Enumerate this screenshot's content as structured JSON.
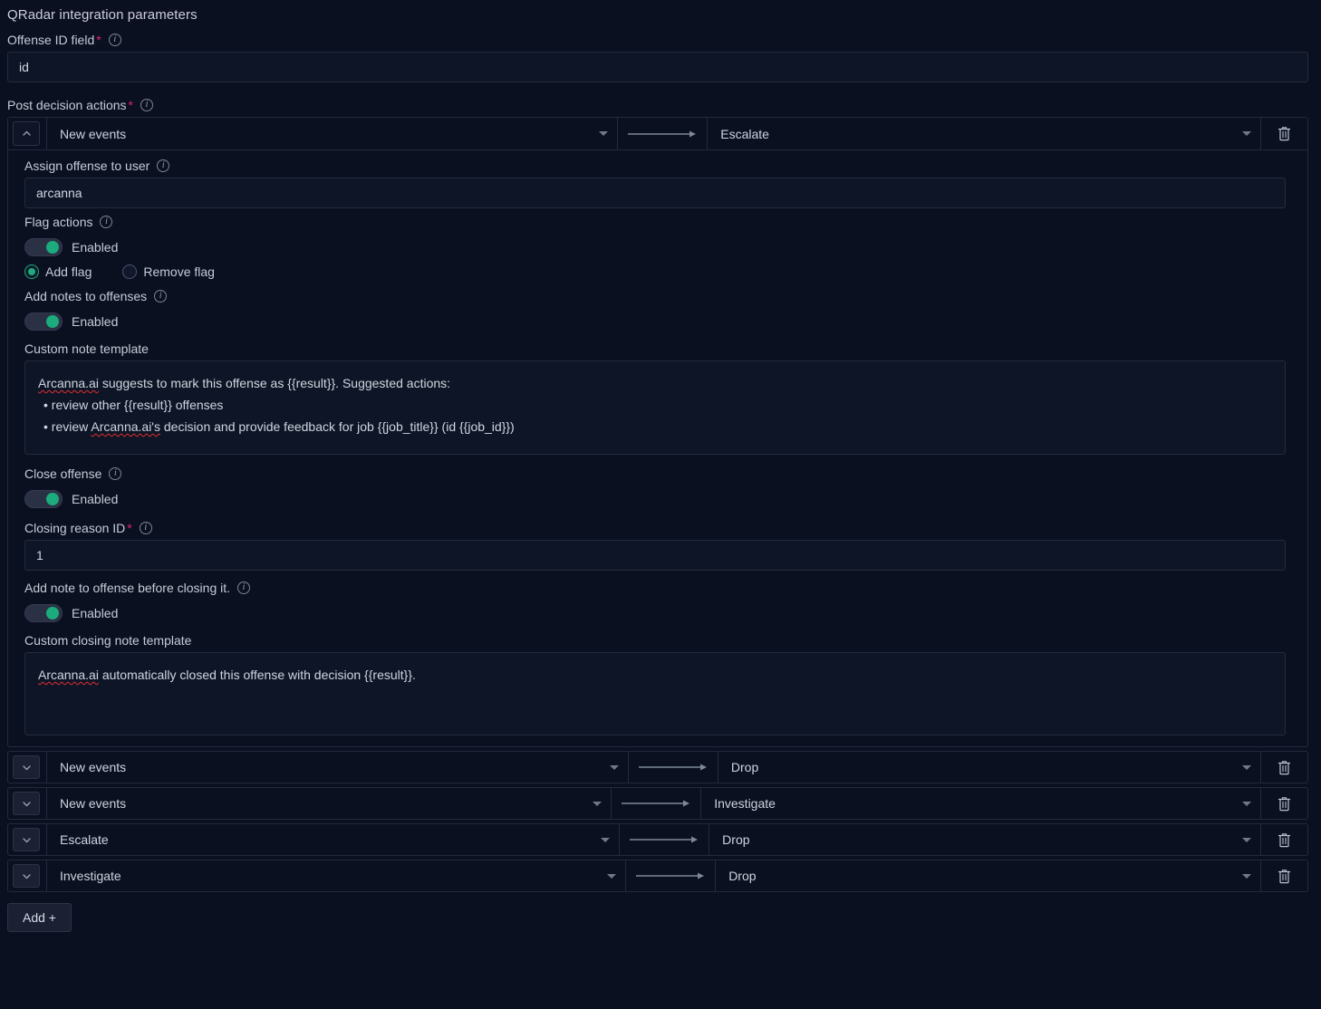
{
  "section": {
    "title": "QRadar integration parameters"
  },
  "offense_id": {
    "label": "Offense ID field",
    "required_marker": "*",
    "info_icon": "info-icon",
    "value": "id"
  },
  "post_decision": {
    "label": "Post decision actions",
    "required_marker": "*",
    "info_icon": "info-icon"
  },
  "expanded_row": {
    "collapse_icon": "chevron-up-icon",
    "trigger": "New events",
    "arrow_icon": "arrow-right-icon",
    "action": "Escalate",
    "delete_icon": "trash-icon",
    "caret_icon": "chevron-down-icon"
  },
  "assign_user": {
    "label": "Assign offense to user",
    "info_icon": "info-icon",
    "value": "arcanna"
  },
  "flag_actions": {
    "label": "Flag actions",
    "info_icon": "info-icon",
    "toggle_label": "Enabled",
    "toggle_on": true,
    "options": [
      {
        "label": "Add flag",
        "selected": true
      },
      {
        "label": "Remove flag",
        "selected": false
      }
    ]
  },
  "add_notes": {
    "label": "Add notes to offenses",
    "info_icon": "info-icon",
    "toggle_label": "Enabled",
    "toggle_on": true,
    "template_label": "Custom note template",
    "template_line1_a": "Arcanna.ai",
    "template_line1_b": " suggests to mark this offense as {{result}}. Suggested actions:",
    "template_line2": "• review other {{result}} offenses",
    "template_line3_a": "• review ",
    "template_line3_b": "Arcanna.ai's",
    "template_line3_c": " decision and provide feedback for job {{job_title}} (id {{job_id}})"
  },
  "close_offense": {
    "label": "Close offense",
    "info_icon": "info-icon",
    "toggle_label": "Enabled",
    "toggle_on": true
  },
  "closing_reason": {
    "label": "Closing reason ID",
    "required_marker": "*",
    "info_icon": "info-icon",
    "value": "1"
  },
  "note_before_closing": {
    "label": "Add note to offense before closing it.",
    "info_icon": "info-icon",
    "toggle_label": "Enabled",
    "toggle_on": true,
    "template_label": "Custom closing note template",
    "template_a": "Arcanna.ai",
    "template_b": " automatically closed this offense with decision {{result}}."
  },
  "collapsed_rows": [
    {
      "expand_icon": "chevron-down-icon",
      "trigger": "New events",
      "arrow_icon": "arrow-right-icon",
      "action": "Drop",
      "delete_icon": "trash-icon"
    },
    {
      "expand_icon": "chevron-down-icon",
      "trigger": "New events",
      "arrow_icon": "arrow-right-icon",
      "action": "Investigate",
      "delete_icon": "trash-icon"
    },
    {
      "expand_icon": "chevron-down-icon",
      "trigger": "Escalate",
      "arrow_icon": "arrow-right-icon",
      "action": "Drop",
      "delete_icon": "trash-icon"
    },
    {
      "expand_icon": "chevron-down-icon",
      "trigger": "Investigate",
      "arrow_icon": "arrow-right-icon",
      "action": "Drop",
      "delete_icon": "trash-icon"
    }
  ],
  "add_button": {
    "label": "Add +"
  },
  "colors": {
    "background": "#0b1021",
    "input_bg": "#0e1526",
    "border": "#232b3d",
    "accent_green": "#1bab7c",
    "required_red": "#e0226e",
    "text": "#c7d0db"
  }
}
